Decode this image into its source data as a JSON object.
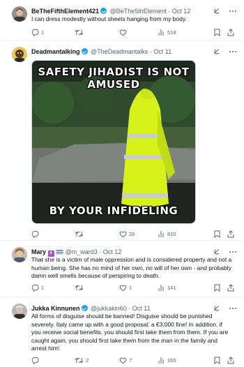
{
  "tweets": [
    {
      "name": "BeTheFifthElement421",
      "handle": "@BeThe5thElement",
      "sep": "·",
      "date": "Oct 12",
      "text": "I can dress modestly without sheets hanging from my body.",
      "replies": "1",
      "retweets": "",
      "likes": "",
      "views": "518"
    },
    {
      "name": "Deadmantalking",
      "handle": "@TheDeadmantalks",
      "sep": "·",
      "date": "Oct 11",
      "image_caption_top_1": "SAFETY JIHADIST IS NOT",
      "image_caption_top_2": "AMUSED",
      "image_caption_bottom": "BY YOUR INFIDELING",
      "replies": "",
      "retweets": "",
      "likes": "28",
      "views": "810"
    },
    {
      "name": "Mary",
      "name_emoji": "✝",
      "handle": "@m_ward3",
      "sep": "·",
      "date": "Oct 12",
      "text": "That she is a victim of male oppression and is considered property and not a human being. She has no mind of her own, no will of her own - and probably damn well smells because of perspiring to death.",
      "replies": "1",
      "retweets": "",
      "likes": "1",
      "views": "141"
    },
    {
      "name": "Jukka Kinnunen",
      "handle": "@jukkakin60",
      "sep": "·",
      "date": "Oct 11",
      "text": "All forms of disguise should be banned! Disguise should be punished severely. Italy came up with a good proposal: a €3,000 fine! In addition, if you receive social benefits, you should first take them from them. If you are caught again, you should first take them from the man in the family and arrest him!",
      "replies": "",
      "retweets": "2",
      "likes": "7",
      "views": "165"
    }
  ],
  "colors": {
    "text": "#0f1419",
    "muted": "#536471",
    "verified": "#1d9bf0",
    "divider": "#eff3f4",
    "vest_yellow": "#d6f21a"
  },
  "icons": [
    "grok-icon",
    "more-icon",
    "reply-icon",
    "retweet-icon",
    "like-icon",
    "views-icon",
    "bookmark-icon",
    "share-icon"
  ]
}
